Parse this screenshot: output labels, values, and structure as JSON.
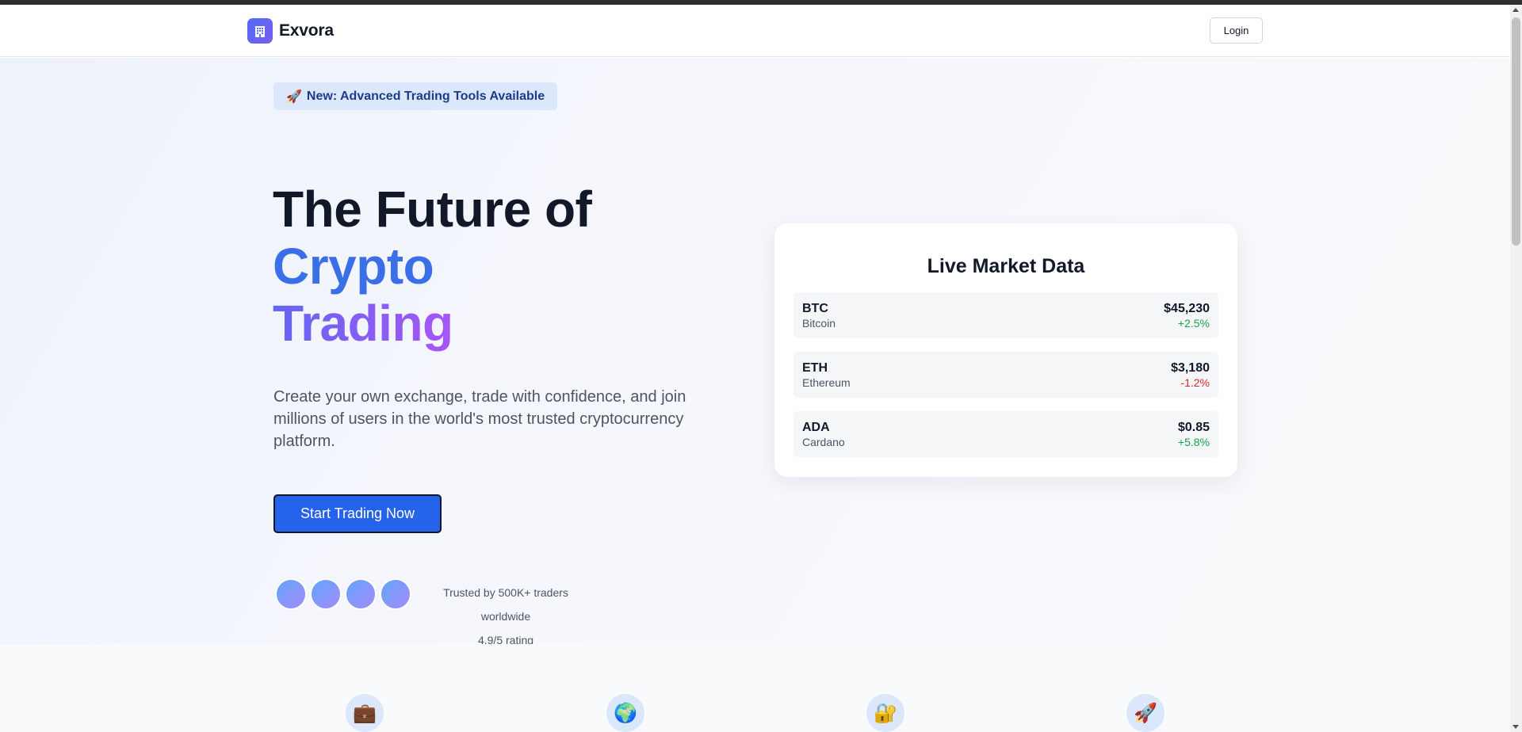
{
  "brand": {
    "name": "Exvora",
    "logo_icon": "building-icon",
    "accent": "#4f6df5"
  },
  "nav": {
    "login_label": "Login"
  },
  "hero": {
    "badge_icon": "🚀",
    "badge_text": "New: Advanced Trading Tools Available",
    "headline_part1": "The Future of ",
    "headline_accent1": "Crypto",
    "headline_accent2": "Trading",
    "subtext": "Create your own exchange, trade with confidence, and join millions of users in the world's most trusted cryptocurrency platform.",
    "cta_label": "Start Trading Now",
    "trust_text": "Trusted by 500K+ traders worldwide",
    "rating_text": "4.9/5 rating",
    "cta_color": "#2563eb"
  },
  "market": {
    "title": "Live Market Data",
    "coins": [
      {
        "symbol": "BTC",
        "name": "Bitcoin",
        "price": "$45,230",
        "change": "+2.5%",
        "trend": "up"
      },
      {
        "symbol": "ETH",
        "name": "Ethereum",
        "price": "$3,180",
        "change": "-1.2%",
        "trend": "down"
      },
      {
        "symbol": "ADA",
        "name": "Cardano",
        "price": "$0.85",
        "change": "+5.8%",
        "trend": "up"
      }
    ]
  },
  "features": {
    "icons": [
      {
        "glyph": "💼",
        "name": "briefcase-icon"
      },
      {
        "glyph": "🌍",
        "name": "globe-icon"
      },
      {
        "glyph": "🔐",
        "name": "lock-icon"
      },
      {
        "glyph": "🚀",
        "name": "rocket-icon"
      }
    ]
  },
  "colors": {
    "up": "#16a34a",
    "down": "#dc2626",
    "heading": "#111827"
  }
}
